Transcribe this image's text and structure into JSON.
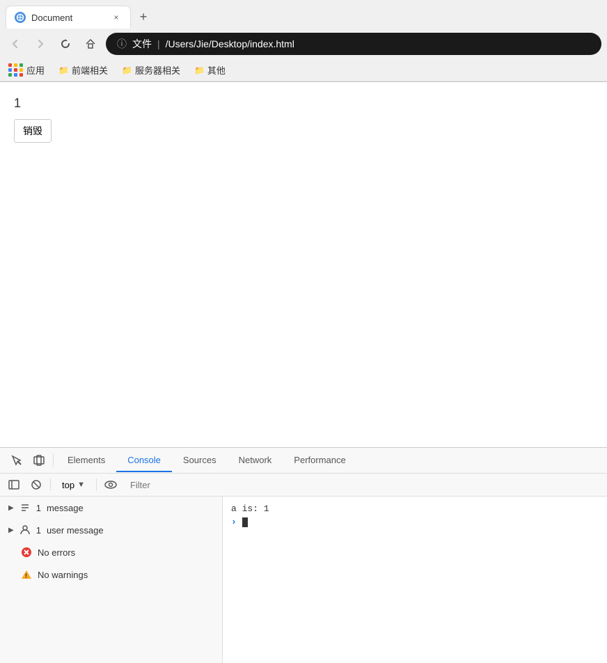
{
  "browser": {
    "tab": {
      "favicon_label": "globe",
      "title": "Document",
      "close_label": "×"
    },
    "new_tab_label": "+",
    "nav": {
      "back_label": "‹",
      "forward_label": "›",
      "reload_label": "↻",
      "home_label": "⌂"
    },
    "address": {
      "info_icon": "ⓘ",
      "file_label": "文件",
      "separator": "|",
      "path": "/Users/Jie/Desktop/index.html"
    },
    "bookmarks": [
      {
        "icon": "apps",
        "label": "应用"
      },
      {
        "icon": "folder",
        "label": "前端相关"
      },
      {
        "icon": "folder",
        "label": "服务器相关"
      },
      {
        "icon": "folder",
        "label": "其他"
      }
    ]
  },
  "page": {
    "number": "1",
    "button_label": "销毁"
  },
  "devtools": {
    "tool_buttons": [
      {
        "name": "inspect",
        "label": "⬡"
      },
      {
        "name": "device",
        "label": "▭"
      }
    ],
    "tabs": [
      {
        "id": "elements",
        "label": "Elements"
      },
      {
        "id": "console",
        "label": "Console"
      },
      {
        "id": "sources",
        "label": "Sources"
      },
      {
        "id": "network",
        "label": "Network"
      },
      {
        "id": "performance",
        "label": "Performance"
      }
    ],
    "active_tab": "console",
    "toolbar": {
      "sidebar_btn": "◧",
      "ban_btn": "⊘",
      "context": "top",
      "dropdown": "▼",
      "eye_label": "👁",
      "filter_placeholder": "Filter"
    },
    "sidebar": {
      "items": [
        {
          "id": "messages",
          "icon": "list",
          "count": "1",
          "label": "message"
        },
        {
          "id": "user-messages",
          "icon": "user",
          "count": "1",
          "label": "user message"
        },
        {
          "id": "errors",
          "icon": "error",
          "count": null,
          "label": "No errors"
        },
        {
          "id": "warnings",
          "icon": "warning",
          "count": null,
          "label": "No warnings"
        }
      ]
    },
    "console": {
      "lines": [
        {
          "type": "log",
          "text": "a is: 1"
        },
        {
          "type": "input",
          "text": ""
        }
      ]
    }
  }
}
